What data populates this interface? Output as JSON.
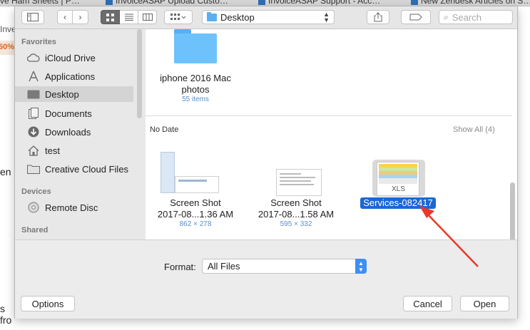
{
  "background_tabs": [
    {
      "label": "ve Ham Sheets | P…"
    },
    {
      "label": "InvoiceASAP Upload Custo…"
    },
    {
      "label": "InvoiceASAP Support - Acc…"
    },
    {
      "label": "New Zendesk Articles on S…"
    }
  ],
  "background_page": {
    "text1": "Inve",
    "badge": "50%",
    "text3": "en",
    "text4": "s fro"
  },
  "toolbar": {
    "location": "Desktop",
    "search_placeholder": "Search"
  },
  "sidebar": {
    "favorites_header": "Favorites",
    "items": [
      {
        "label": "iCloud Drive",
        "icon": "cloud-icon"
      },
      {
        "label": "Applications",
        "icon": "applications-icon"
      },
      {
        "label": "Desktop",
        "icon": "desktop-icon"
      },
      {
        "label": "Documents",
        "icon": "documents-icon"
      },
      {
        "label": "Downloads",
        "icon": "downloads-icon"
      },
      {
        "label": "test",
        "icon": "home-icon"
      },
      {
        "label": "Creative Cloud Files",
        "icon": "folder-icon"
      }
    ],
    "devices_header": "Devices",
    "devices": [
      {
        "label": "Remote Disc",
        "icon": "disc-icon"
      }
    ],
    "shared_header": "Shared"
  },
  "browser": {
    "folder": {
      "name_line1": "iphone 2016 Mac",
      "name_line2": "photos",
      "count": "55 items"
    },
    "section_title": "No Date",
    "show_all": "Show All (4)",
    "files": [
      {
        "name_line1": "Screen Shot",
        "name_line2": "2017-08...1.36 AM",
        "dims": "862 × 278"
      },
      {
        "name_line1": "Screen Shot",
        "name_line2": "2017-08...1.58 AM",
        "dims": "595 × 332"
      },
      {
        "name_line1": "Services-082417",
        "badge": "XLS"
      }
    ]
  },
  "bottom": {
    "format_label": "Format:",
    "format_value": "All Files",
    "options_label": "Options",
    "cancel_label": "Cancel",
    "open_label": "Open"
  },
  "colors": {
    "selection": "#1c67d6",
    "annotation_arrow": "#e8392b",
    "popup_arrow": "#3d8ff5"
  }
}
